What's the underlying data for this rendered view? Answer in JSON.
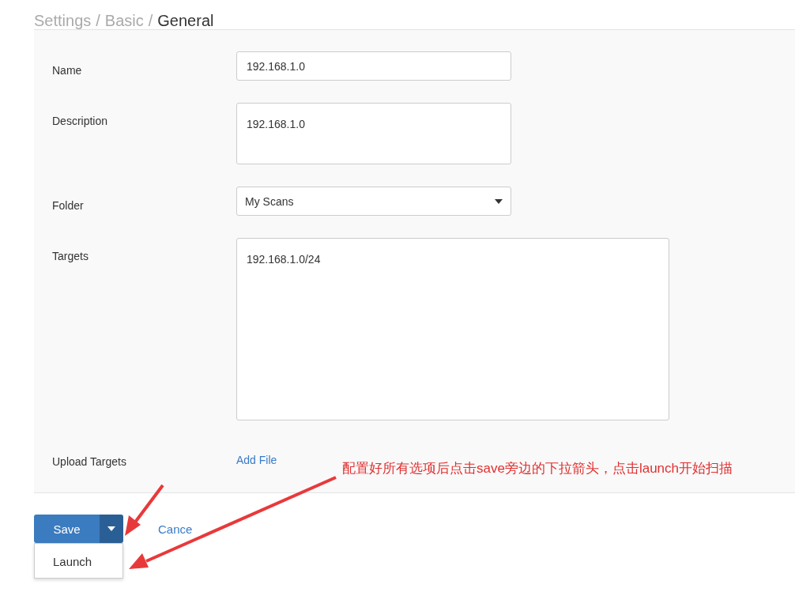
{
  "breadcrumb": [
    {
      "label": "Settings",
      "current": false
    },
    {
      "label": "Basic",
      "current": false
    },
    {
      "label": "General",
      "current": true
    }
  ],
  "separator": "/",
  "form": {
    "fields": [
      {
        "label": "Name",
        "kind": "text",
        "value": "192.168.1.0"
      },
      {
        "label": "Description",
        "kind": "textarea",
        "value": "192.168.1.0"
      },
      {
        "label": "Folder",
        "kind": "select",
        "value": "My Scans"
      },
      {
        "label": "Targets",
        "kind": "bigtextarea",
        "value": "192.168.1.0/24"
      },
      {
        "label": "Upload Targets",
        "kind": "link",
        "value": "Add File"
      }
    ]
  },
  "annotation": "配置好所有选项后点击save旁边的下拉箭头，点击launch开始扫描",
  "save_button": {
    "label": "Save",
    "menu_open": true
  },
  "menu_items": [
    "Launch"
  ],
  "cancel_link": "Cance"
}
